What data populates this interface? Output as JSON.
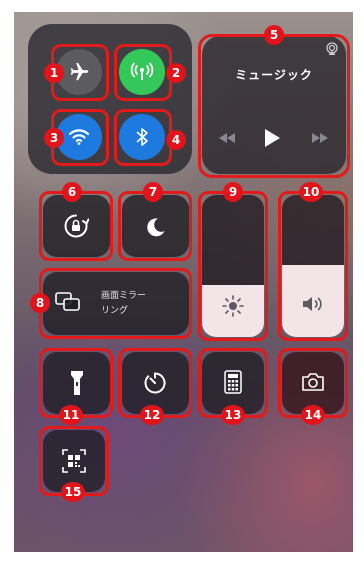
{
  "music": {
    "title": "ミュージック",
    "controls": [
      "rewind-icon",
      "play-icon",
      "fast-forward-icon"
    ]
  },
  "screen_mirroring": {
    "label": "画面ミラー\nリング"
  },
  "connectivity": {
    "airplane_mode": {
      "icon": "airplane-icon",
      "active": false
    },
    "cellular_data": {
      "icon": "antenna-icon",
      "active": true,
      "color": "#34c759"
    },
    "wifi": {
      "icon": "wifi-icon",
      "active": true,
      "color": "#1f7ae0"
    },
    "bluetooth": {
      "icon": "bluetooth-icon",
      "active": true,
      "color": "#1f7ae0"
    }
  },
  "sliders": {
    "brightness_level": 0.3,
    "volume_level": 0.5
  },
  "callouts": [
    "1",
    "2",
    "3",
    "4",
    "5",
    "6",
    "7",
    "8",
    "9",
    "10",
    "11",
    "12",
    "13",
    "14",
    "15"
  ],
  "colors": {
    "callout": "#e0141a",
    "active_green": "#34c759",
    "active_blue": "#1f7ae0"
  }
}
